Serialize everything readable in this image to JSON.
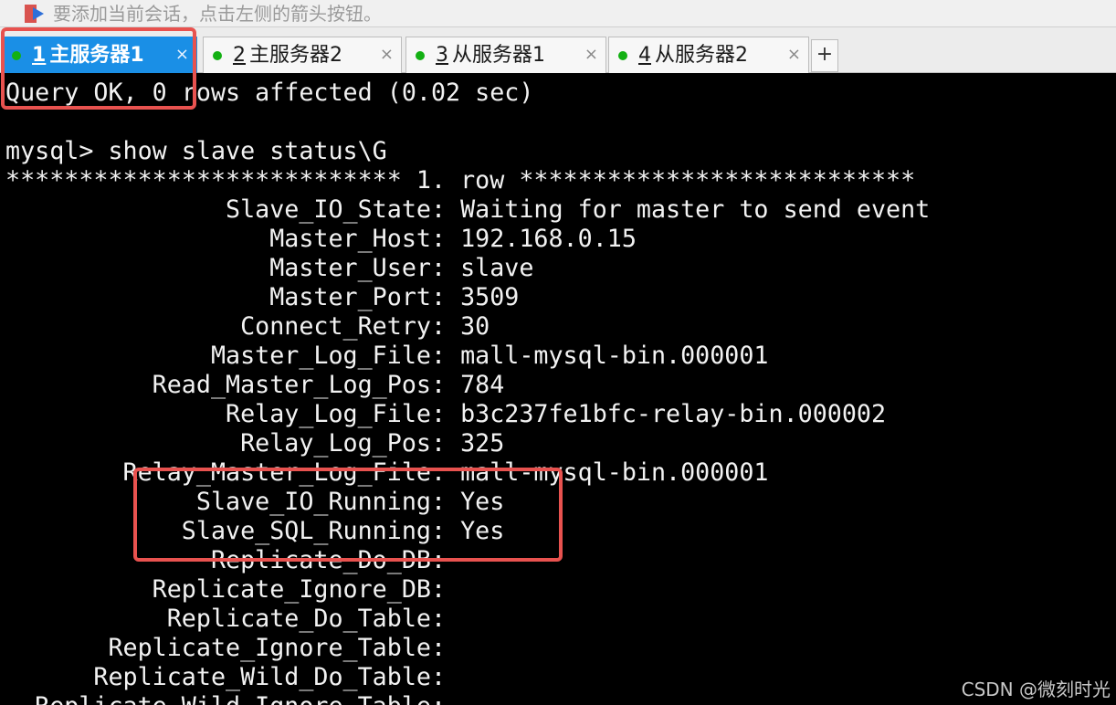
{
  "hint_bar": {
    "text": "要添加当前会话，点击左侧的箭头按钮。",
    "icon": "session-arrow-icon"
  },
  "tabs": [
    {
      "number": "1",
      "title": "主服务器1",
      "active": true,
      "status": "connected"
    },
    {
      "number": "2",
      "title": "主服务器2",
      "active": false,
      "status": "connected"
    },
    {
      "number": "3",
      "title": "从服务器1",
      "active": false,
      "status": "connected"
    },
    {
      "number": "4",
      "title": "从服务器2",
      "active": false,
      "status": "connected"
    }
  ],
  "tab_close_symbol": "×",
  "add_tab_symbol": "+",
  "terminal": {
    "lines": [
      "Query OK, 0 rows affected (0.02 sec)",
      "",
      "mysql> show slave status\\G",
      "*************************** 1. row ***************************",
      "               Slave_IO_State: Waiting for master to send event",
      "                  Master_Host: 192.168.0.15",
      "                  Master_User: slave",
      "                  Master_Port: 3509",
      "                Connect_Retry: 30",
      "              Master_Log_File: mall-mysql-bin.000001",
      "          Read_Master_Log_Pos: 784",
      "               Relay_Log_File: b3c237fe1bfc-relay-bin.000002",
      "                Relay_Log_Pos: 325",
      "        Relay_Master_Log_File: mall-mysql-bin.000001",
      "             Slave_IO_Running: Yes",
      "            Slave_SQL_Running: Yes",
      "              Replicate_Do_DB: ",
      "          Replicate_Ignore_DB: ",
      "           Replicate_Do_Table: ",
      "       Replicate_Ignore_Table: ",
      "      Replicate_Wild_Do_Table: ",
      "  Replicate_Wild_Ignore_Table: "
    ]
  },
  "watermark": "CSDN @微刻时光",
  "colors": {
    "active_tab": "#1a8fe6",
    "status_dot": "#13b013",
    "annotation": "#e8524f",
    "terminal_bg": "#000000",
    "terminal_fg": "#f2f2f2"
  }
}
